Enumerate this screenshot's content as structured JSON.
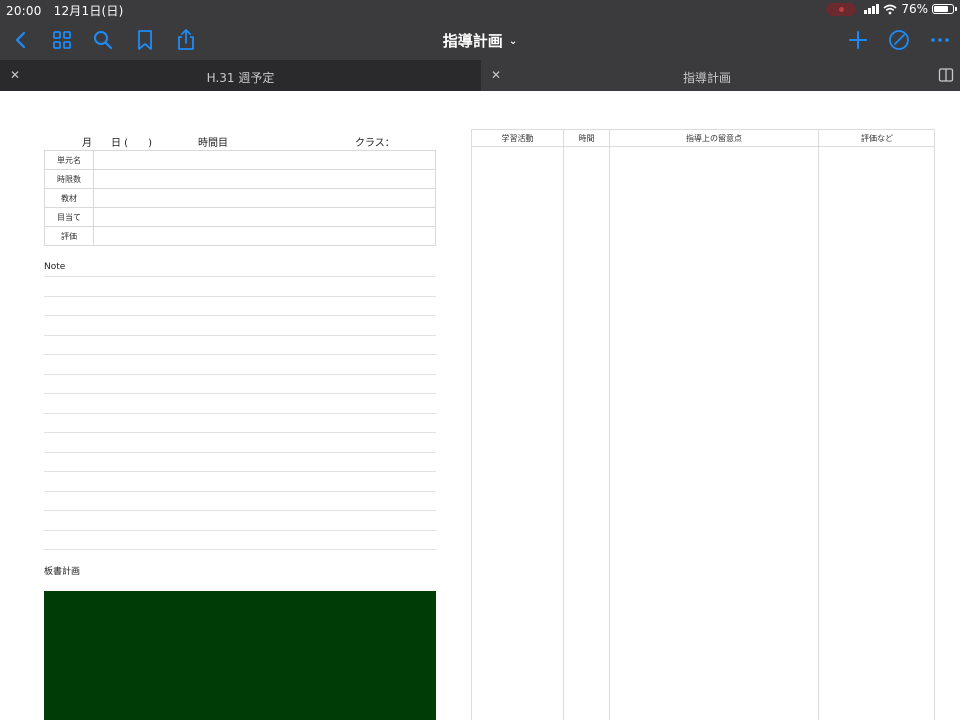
{
  "status_bar": {
    "time": "20:00",
    "date": "12月1日(日)",
    "battery_level": 76,
    "battery_text": "76%"
  },
  "nav": {
    "title": "指導計画",
    "icons": [
      "back-icon",
      "grid-icon",
      "search-icon",
      "bookmark-icon",
      "share-icon",
      "add-icon",
      "pen-icon",
      "more-icon"
    ],
    "accent_color": "#1e8bf5"
  },
  "tabs": [
    {
      "label": "H.31 週予定",
      "active": true
    },
    {
      "label": "指導計画",
      "active": false
    }
  ],
  "page": {
    "header": {
      "month": "月",
      "day": "日 (　　)",
      "period": "時間目",
      "class": "クラス："
    },
    "info_rows": [
      {
        "label": "単元名"
      },
      {
        "label": "時限数"
      },
      {
        "label": "教材"
      },
      {
        "label": "目当て"
      },
      {
        "label": "評価"
      }
    ],
    "note_title": "Note",
    "board_title": "板書計画",
    "board_color": "#003d06",
    "plan_columns": [
      "学習活動",
      "時間",
      "指導上の留意点",
      "評価など"
    ]
  }
}
